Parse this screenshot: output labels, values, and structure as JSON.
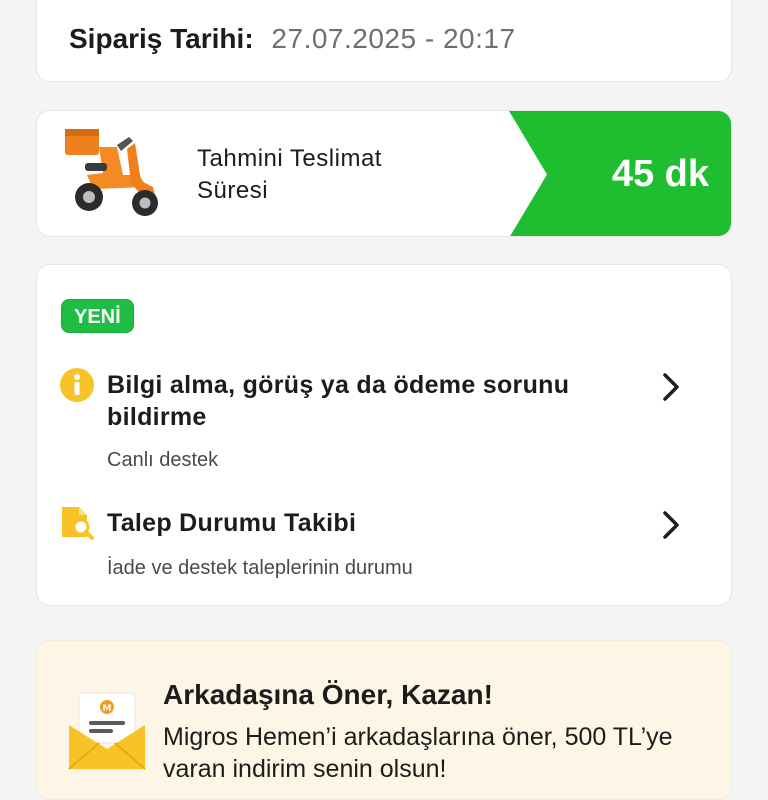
{
  "order": {
    "date_label": "Sipariş Tarihi:",
    "date_value": "27.07.2025 - 20:17"
  },
  "delivery": {
    "label": "Tahmini Teslimat Süresi",
    "time": "45 dk",
    "banner_color": "#1fbe30"
  },
  "support": {
    "badge": "YENİ",
    "items": [
      {
        "title": "Bilgi alma, görüş ya da ödeme sorunu bildirme",
        "subtitle": "Canlı destek",
        "icon": "info-icon"
      },
      {
        "title": "Talep Durumu Takibi",
        "subtitle": "İade ve destek taleplerinin durumu",
        "icon": "document-search-icon"
      }
    ]
  },
  "referral": {
    "title": "Arkadaşına Öner, Kazan!",
    "description": "Migros Hemen’i arkadaşlarına öner, 500 TL’ye varan indirim senin olsun!",
    "icon": "envelope-icon"
  },
  "colors": {
    "accent_green": "#1fbe30",
    "accent_yellow": "#f8c326",
    "referral_bg": "#fdf6e6"
  }
}
